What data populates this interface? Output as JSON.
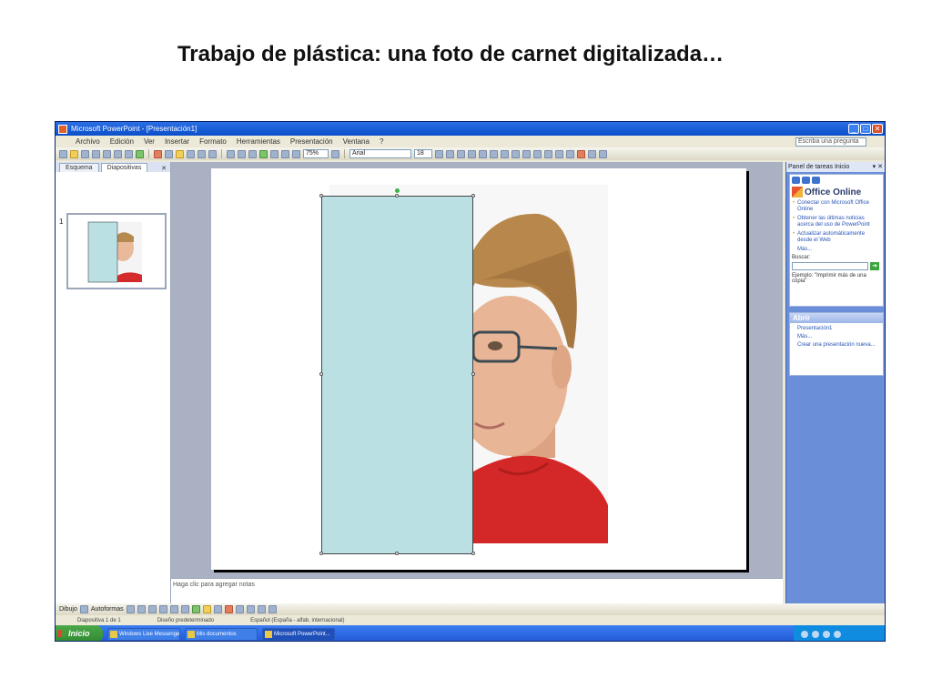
{
  "slide_title": "Trabajo de plástica: una foto de carnet digitalizada…",
  "window": {
    "title": "Microsoft PowerPoint - [Presentación1]",
    "menu": [
      "Archivo",
      "Edición",
      "Ver",
      "Insertar",
      "Formato",
      "Herramientas",
      "Presentación",
      "Ventana",
      "?"
    ],
    "help_placeholder": "Escriba una pregunta",
    "zoom": "75%",
    "font_name": "Arial",
    "font_size": "18"
  },
  "left_pane": {
    "tabs": [
      "Esquema",
      "Diapositivas"
    ],
    "slide_number": "1"
  },
  "notes_placeholder": "Haga clic para agregar notas",
  "task_pane": {
    "title": "Panel de tareas Inicio",
    "brand": "Office Online",
    "links": [
      "Conectar con Microsoft Office Online",
      "Obtener las últimas noticias acerca del uso de PowerPoint",
      "Actualizar automáticamente desde el Web"
    ],
    "more": "Más...",
    "search_label": "Buscar:",
    "search_example": "Ejemplo: \"Imprimir más de una copia\"",
    "open_header": "Abrir",
    "open_rows": [
      "Presentación1",
      "Más...",
      "Crear una presentación nueva..."
    ]
  },
  "drawbar": {
    "draw_label": "Dibujo",
    "autoshapes_label": "Autoformas"
  },
  "statusbar": [
    "Diapositiva 1 de 1",
    "Diseño predeterminado",
    "Español (España - alfab. internacional)"
  ],
  "taskbar": {
    "start": "Inicio",
    "buttons": [
      "Windows Live Messenger",
      "Mis documentos",
      "Microsoft PowerPoint..."
    ]
  },
  "colors": {
    "rect_fill": "#bae0e3",
    "xp_blue": "#2257d4",
    "task_pane": "#6b8ed8"
  }
}
